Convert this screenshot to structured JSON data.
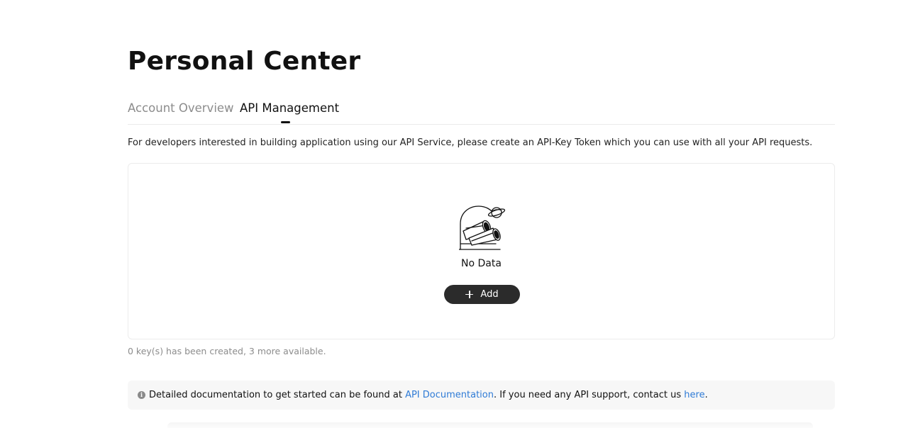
{
  "page": {
    "title": "Personal Center"
  },
  "tabs": [
    {
      "label": "Account Overview",
      "active": false
    },
    {
      "label": "API Management",
      "active": true
    }
  ],
  "api": {
    "description": "For developers interested in building application using our API Service, please create an API-Key Token which you can use with all your API requests.",
    "empty_state": {
      "icon": "binoculars-planet-icon",
      "text": "No Data"
    },
    "add_button": {
      "icon": "plus-icon",
      "label": "Add"
    },
    "quota_text": "0 key(s) has been created, 3 more available."
  },
  "info": {
    "icon": "info-icon",
    "text_before": "Detailed documentation to get started can be found at ",
    "doc_link": "API Documentation",
    "text_middle": ". If you need any API support, contact us ",
    "support_link": "here",
    "text_after": "."
  },
  "colors": {
    "link": "#2f7bd6",
    "button_bg": "#2b2b2b",
    "inactive_tab": "#8c8c8c"
  }
}
